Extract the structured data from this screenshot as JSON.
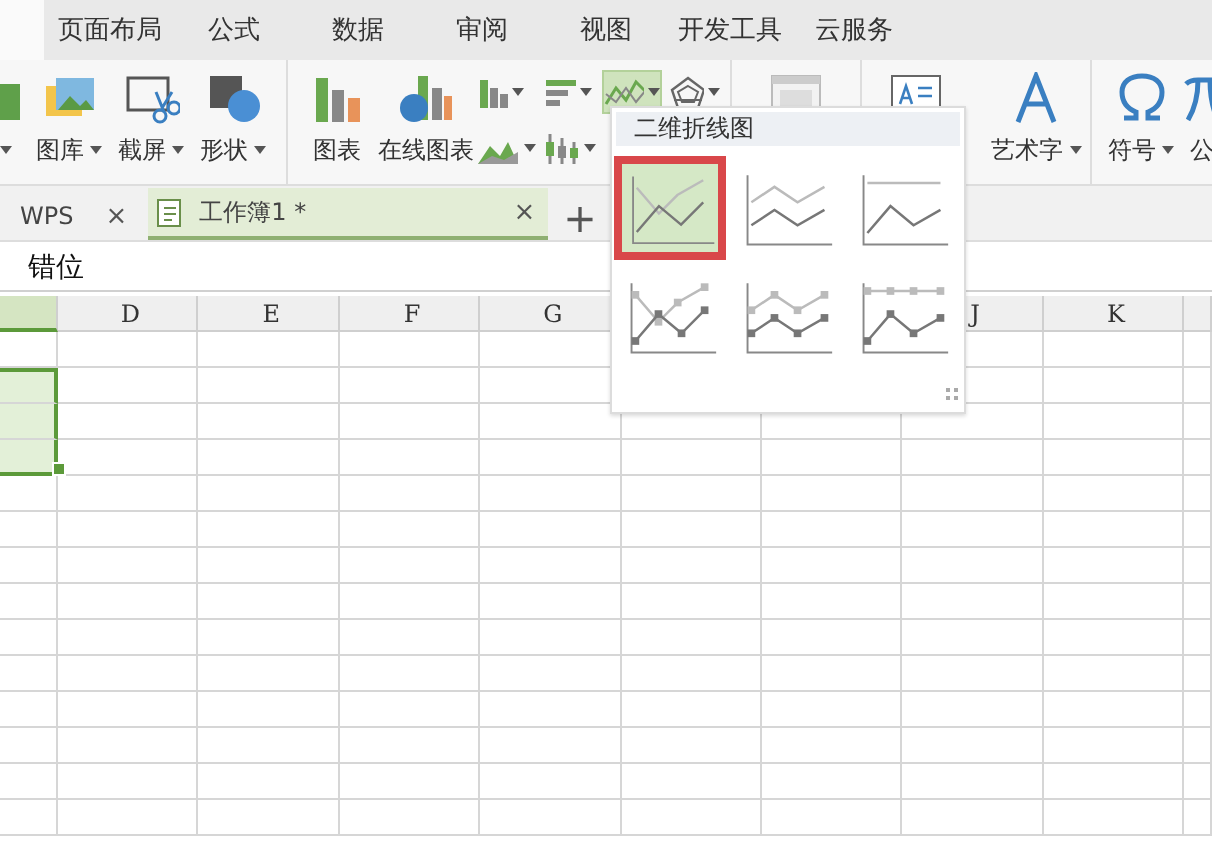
{
  "menu_tabs": [
    {
      "selected": true
    },
    {
      "label": "页面布局",
      "selected": false
    },
    {
      "label": "公式",
      "selected": false
    },
    {
      "label": "数据",
      "selected": false
    },
    {
      "label": "审阅",
      "selected": false
    },
    {
      "label": "视图",
      "selected": false
    },
    {
      "label": "开发工具",
      "selected": false
    },
    {
      "label": "云服务",
      "selected": false
    }
  ],
  "ribbon": {
    "groups": [
      {
        "items": [
          {
            "kind": "large",
            "dropdown": true
          },
          {
            "kind": "large",
            "label": "图库",
            "dropdown": true
          },
          {
            "kind": "large",
            "label": "截屏",
            "dropdown": true
          },
          {
            "kind": "large",
            "label": "形状",
            "dropdown": true
          }
        ]
      },
      {
        "items": [
          {
            "kind": "large",
            "label": "图表",
            "dropdown": false
          },
          {
            "kind": "large",
            "label": "在线图表",
            "dropdown": false
          },
          {
            "kind": "small",
            "dropdown": true,
            "active": false
          },
          {
            "kind": "small",
            "dropdown": true,
            "active": false
          },
          {
            "kind": "small",
            "dropdown": true,
            "active": true
          },
          {
            "kind": "small",
            "dropdown": true,
            "active": false
          },
          {
            "kind": "small",
            "dropdown": true,
            "active": false
          },
          {
            "kind": "small",
            "dropdown": true,
            "active": false
          }
        ]
      },
      {
        "items": [
          {
            "kind": "large",
            "dropdown": false
          }
        ]
      },
      {
        "items": [
          {
            "kind": "large",
            "dropdown": false
          },
          {
            "kind": "large",
            "label": "艺术字",
            "dropdown": true
          }
        ]
      },
      {
        "items": [
          {
            "kind": "large",
            "label": "符号",
            "dropdown": true
          },
          {
            "kind": "large",
            "label": "公",
            "dropdown": false
          }
        ]
      }
    ]
  },
  "doc_tabs": [
    {
      "label": "WPS",
      "selected": false,
      "close": "×"
    },
    {
      "label": "工作簿1 *",
      "selected": true,
      "close": "×"
    }
  ],
  "new_tab": "+",
  "formula_bar": {
    "value": "错位"
  },
  "sheet": {
    "columns": [
      "D",
      "E",
      "F",
      "G",
      null,
      null,
      "J",
      "K"
    ],
    "rows": [
      {
        "selected": false
      },
      {
        "selected": true
      },
      {
        "selected": true
      },
      {
        "selected": true
      },
      {
        "selected": false
      },
      {
        "selected": false
      },
      {
        "selected": false
      },
      {
        "selected": false
      },
      {
        "selected": false
      },
      {
        "selected": false
      },
      {
        "selected": false
      },
      {
        "selected": false
      },
      {
        "selected": false
      },
      {
        "selected": false
      }
    ]
  },
  "dropdown": {
    "title": "二维折线图",
    "options": [
      {
        "kind": "line",
        "selected": true
      },
      {
        "kind": "stacked",
        "selected": false
      },
      {
        "kind": "percent",
        "selected": false
      },
      {
        "kind": "line_markers",
        "selected": false
      },
      {
        "kind": "stacked_markers",
        "selected": false
      },
      {
        "kind": "percent_markers",
        "selected": false
      }
    ]
  }
}
